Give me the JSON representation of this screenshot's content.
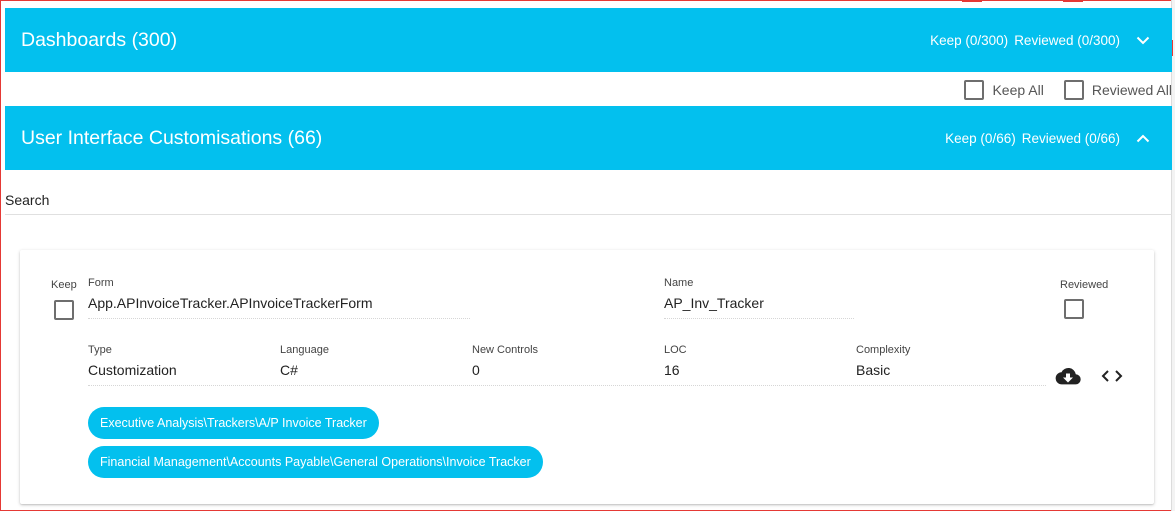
{
  "dashboards_panel": {
    "title": "Dashboards (300)",
    "keep_count": "Keep (0/300)",
    "reviewed_count": "Reviewed (0/300)",
    "expand_icon": "chevron-down-icon"
  },
  "select_all": {
    "keep_all_label": "Keep All",
    "reviewed_all_label": "Reviewed All"
  },
  "ui_customisations_panel": {
    "title": "User Interface Customisations (66)",
    "keep_count": "Keep (0/66)",
    "reviewed_count": "Reviewed (0/66)",
    "collapse_icon": "chevron-up-icon"
  },
  "search": {
    "label": "Search"
  },
  "card": {
    "keep_label": "Keep",
    "reviewed_label": "Reviewed",
    "form_label": "Form",
    "form_value": "App.APInvoiceTracker.APInvoiceTrackerForm",
    "name_label": "Name",
    "name_value": "AP_Inv_Tracker",
    "type_label": "Type",
    "type_value": "Customization",
    "language_label": "Language",
    "language_value": "C#",
    "new_controls_label": "New Controls",
    "new_controls_value": "0",
    "loc_label": "LOC",
    "loc_value": "16",
    "complexity_label": "Complexity",
    "complexity_value": "Basic",
    "download_icon": "cloud-download-icon",
    "code_icon": "code-icon",
    "tags": [
      "Executive Analysis\\Trackers\\A/P Invoice Tracker",
      "Financial Management\\Accounts Payable\\General Operations\\Invoice Tracker"
    ]
  },
  "colors": {
    "header_bg": "#03c0ee",
    "chip_bg": "#03c0ee",
    "frame_border": "#e53935"
  }
}
